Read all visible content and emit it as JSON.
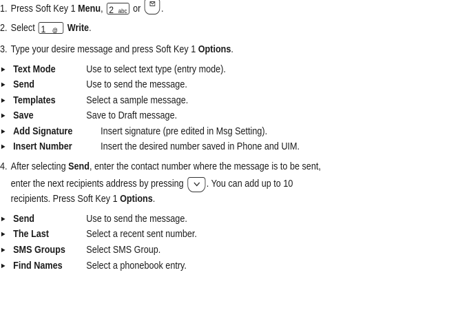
{
  "steps": {
    "s1": {
      "num": "1.",
      "pre": "Press Soft Key 1 ",
      "bold": "Menu",
      "mid": ", ",
      "key_main": "2",
      "key_sub": "abc",
      "or": " or ",
      "end": "."
    },
    "s2": {
      "num": "2.",
      "pre": "Select ",
      "key_main": "1",
      "key_sub": "@",
      "bold": "Write",
      "end": "."
    },
    "s3": {
      "num": "3.",
      "pre": "Type your desire message and press Soft Key 1 ",
      "bold": "Options",
      "end": "."
    },
    "s4": {
      "num": "4.",
      "l1_pre": "After selecting ",
      "l1_bold": "Send",
      "l1_post": ", enter the contact number where the message is to be sent,",
      "l2_pre": "enter the next recipients address by pressing",
      "l2_post": ". You can add up to 10",
      "l3_pre": "recipients. Press Soft Key 1 ",
      "l3_bold": "Options",
      "l3_end": "."
    }
  },
  "options1": [
    {
      "term": "Text Mode",
      "desc": "Use to select text type (entry mode)."
    },
    {
      "term": "Send",
      "desc": "Use to send the message."
    },
    {
      "term": "Templates",
      "desc": "Select a sample message."
    },
    {
      "term": "Save",
      "desc": "Save to Draft message."
    },
    {
      "term": "Add Signature",
      "desc": "Insert signature (pre edited in Msg Setting)."
    },
    {
      "term": "Insert Number",
      "desc": "Insert the desired number saved in Phone and UIM."
    }
  ],
  "options2": [
    {
      "term": "Send",
      "desc": "Use to send the message."
    },
    {
      "term": "The Last",
      "desc": "Select a recent sent number."
    },
    {
      "term": "SMS Groups",
      "desc": "Select SMS Group."
    },
    {
      "term": "Find Names",
      "desc": "Select a phonebook entry."
    }
  ],
  "bullet_glyph": "►",
  "icons": {
    "messaging_key": "envelope-icon",
    "nav_key": "nav-down-icon"
  }
}
